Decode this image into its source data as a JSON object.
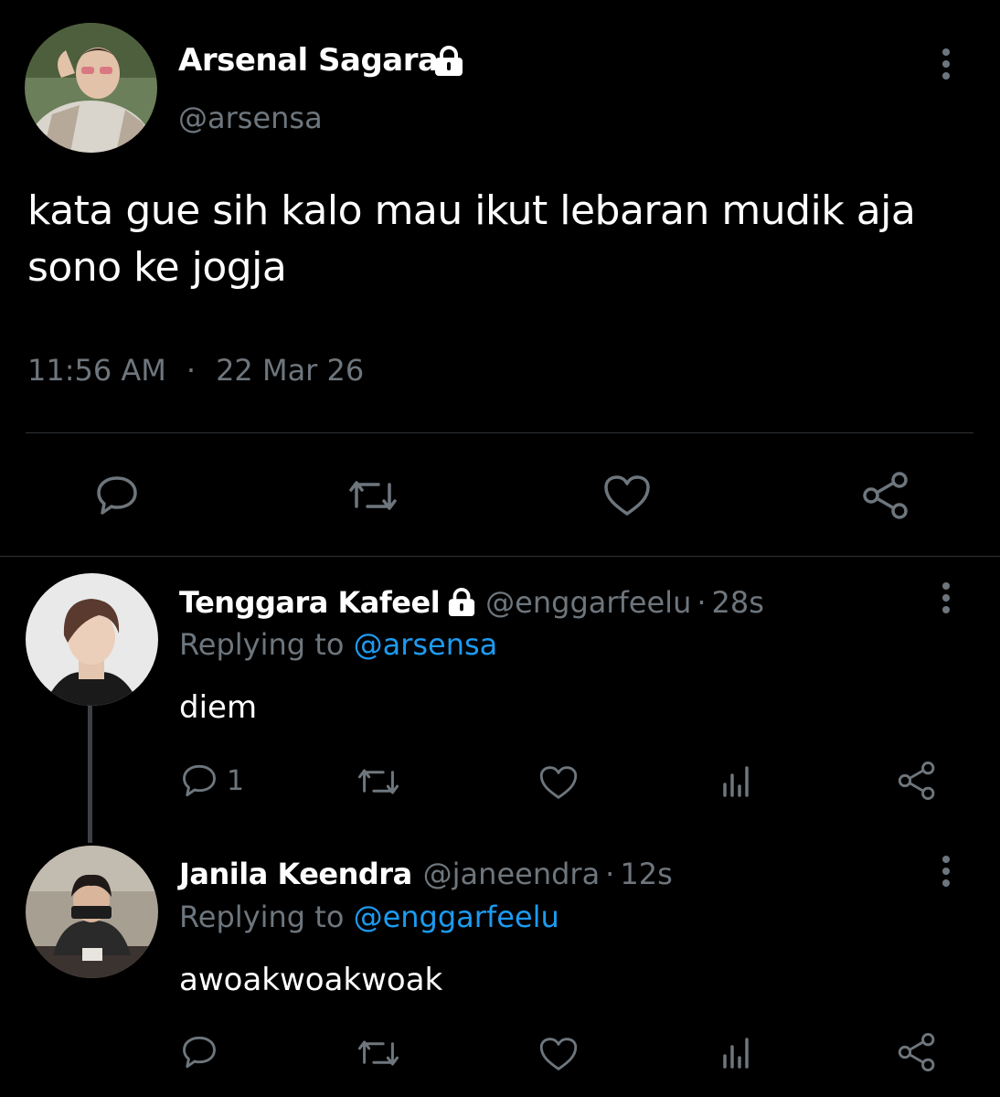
{
  "main_tweet": {
    "author_name": "Arsenal Sagara",
    "handle": "@arsensa",
    "text_line1": "kata gue sih kalo mau ikut lebaran mudik aja",
    "text_line2": "sono ke jogja",
    "time": "11:56 AM",
    "separator": "·",
    "date": "22 Mar 26",
    "protected": true
  },
  "replies": [
    {
      "author_name": "Tenggara Kafeel",
      "handle": "@enggarfeelu",
      "dot": "·",
      "age": "28s",
      "replying_prefix": "Replying to",
      "replying_to": "@arsensa",
      "text": "diem",
      "reply_count": "1",
      "protected": true
    },
    {
      "author_name": "Janila Keendra",
      "handle": "@janeendra",
      "dot": "·",
      "age": "12s",
      "replying_prefix": "Replying to",
      "replying_to": "@enggarfeelu",
      "text": "awoakwoakwoak",
      "reply_count": "",
      "protected": false
    }
  ],
  "icons": [
    "reply-icon",
    "retweet-icon",
    "like-icon",
    "share-icon",
    "analytics-icon",
    "lock-icon",
    "more-icon"
  ],
  "colors": {
    "background": "#000000",
    "text": "#e7e9ea",
    "muted": "#6e767d",
    "link": "#1d9bf0",
    "divider": "#2f3336"
  }
}
